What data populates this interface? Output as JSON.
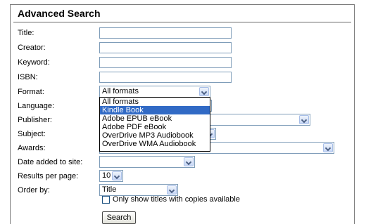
{
  "form": {
    "title": "Advanced Search",
    "labels": {
      "title": "Title:",
      "creator": "Creator:",
      "keyword": "Keyword:",
      "isbn": "ISBN:",
      "format": "Format:",
      "language": "Language:",
      "publisher": "Publisher:",
      "subject": "Subject:",
      "awards": "Awards:",
      "date_added": "Date added to site:",
      "results_per_page": "Results per page:",
      "order_by": "Order by:"
    },
    "format_value": "All formats",
    "format_options": [
      "All formats",
      "Kindle Book",
      "Adobe EPUB eBook",
      "Adobe PDF eBook",
      "OverDrive MP3 Audiobook",
      "OverDrive WMA Audiobook"
    ],
    "format_highlighted": "Kindle Book",
    "results_per_page_value": "10",
    "order_by_value": "Title",
    "copies_checkbox_label": "Only show titles with copies available",
    "copies_checkbox_checked": false,
    "search_button_label": "Search"
  },
  "colors": {
    "highlight": "#316ac5",
    "field_border": "#7f9db9"
  }
}
